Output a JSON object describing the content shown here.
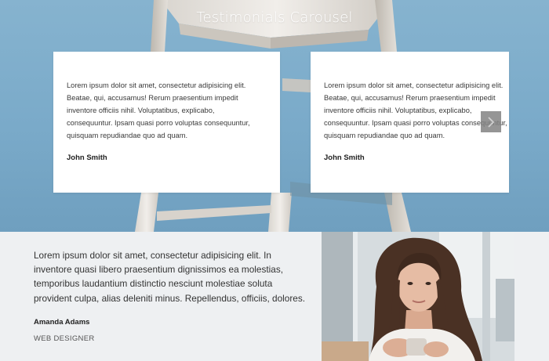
{
  "hero": {
    "title": "Testimonials Carousel",
    "background_color": "#7aaac9"
  },
  "carousel": {
    "next_icon": "chevron-right-icon",
    "cards": [
      {
        "text": "Lorem ipsum dolor sit amet, consectetur adipisicing elit.\nBeatae, qui, accusamus! Rerum praesentium impedit\ninventore officiis nihil. Voluptatibus, explicabo,\nconsequuntur. Ipsam quasi porro voluptas consequuntur,\nquisquam repudiandae quo ad quam.",
        "author": "John Smith"
      },
      {
        "text": "Lorem ipsum dolor sit amet, consectetur adipisicing elit.\nBeatae, qui, accusamus! Rerum praesentium impedit\ninventore officiis nihil. Voluptatibus, explicabo,\nconsequuntur. Ipsam quasi porro voluptas consequuntur,\nquisquam repudiandae quo ad quam.",
        "author": "John Smith"
      }
    ]
  },
  "featured": {
    "quote": "Lorem ipsum dolor sit amet, consectetur adipisicing elit. In\ninventore quasi libero praesentium dignissimos ea molestias,\ntemporibus laudantium distinctio nesciunt molestiae soluta\nprovident culpa, alias deleniti minus. Repellendus, officiis, dolores.",
    "name": "Amanda Adams",
    "role": "WEB DESIGNER",
    "background_color": "#eef0f2"
  }
}
